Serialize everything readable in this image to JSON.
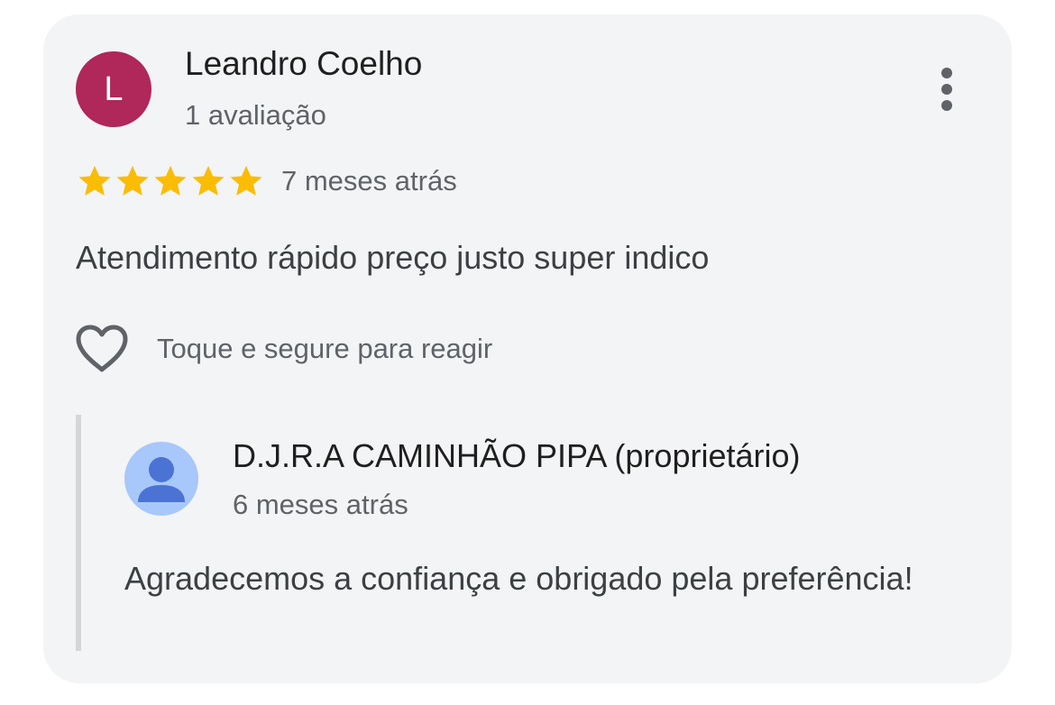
{
  "review": {
    "avatar_letter": "L",
    "avatar_color": "#b0275a",
    "reviewer_name": "Leandro Coelho",
    "review_count": "1 avaliação",
    "rating": 5,
    "rating_max": 5,
    "star_color": "#fbbc04",
    "time": "7 meses atrás",
    "text": "Atendimento rápido preço justo super indico",
    "more_icon": "more-vert-icon"
  },
  "reaction": {
    "icon": "heart-outline-icon",
    "label": "Toque e segure para reagir"
  },
  "owner_reply": {
    "avatar_icon": "person-icon",
    "avatar_color": "#a8c7fa",
    "name": "D.J.R.A CAMINHÃO PIPA (proprietário)",
    "time": "6 meses atrás",
    "text": "Agradecemos a confiança e obrigado pela preferência!"
  }
}
